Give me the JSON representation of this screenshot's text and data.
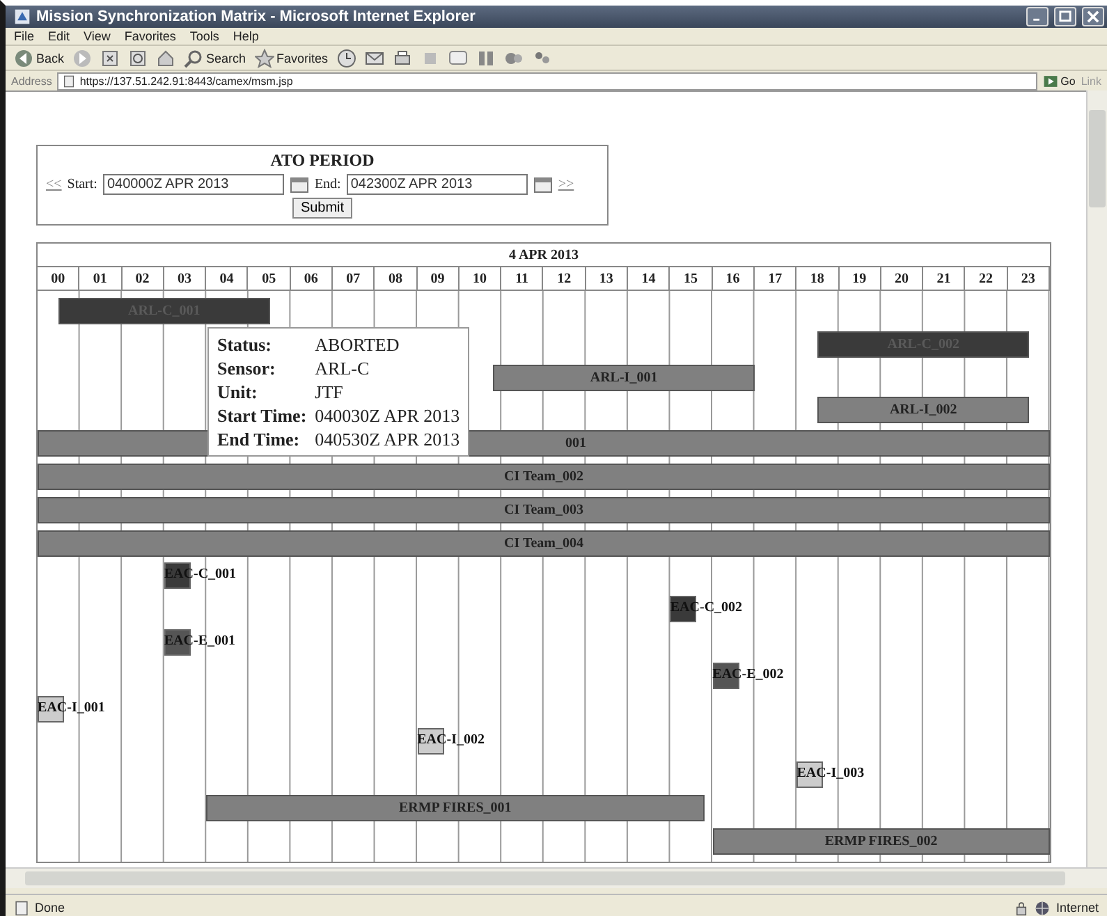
{
  "window": {
    "title": "Mission Synchronization Matrix - Microsoft Internet Explorer"
  },
  "menu": [
    "File",
    "Edit",
    "View",
    "Favorites",
    "Tools",
    "Help"
  ],
  "toolbar": {
    "back": "Back",
    "search": "Search",
    "favorites": "Favorites"
  },
  "address": {
    "label": "Address",
    "url": "https://137.51.242.91:8443/camex/msm.jsp",
    "go": "Go",
    "links": "Link"
  },
  "ato_period": {
    "title": "ATO PERIOD",
    "prev": "<<",
    "start_label": "Start:",
    "start_value": "040000Z APR 2013",
    "end_label": "End:",
    "end_value": "042300Z APR 2013",
    "next": ">>",
    "submit": "Submit"
  },
  "matrix": {
    "date": "4 APR 2013",
    "hours": [
      "00",
      "01",
      "02",
      "03",
      "04",
      "05",
      "06",
      "07",
      "08",
      "09",
      "10",
      "11",
      "12",
      "13",
      "14",
      "15",
      "16",
      "17",
      "18",
      "19",
      "20",
      "21",
      "22",
      "23"
    ],
    "rows": [
      {
        "label": "ARL-C_001",
        "kind": "span",
        "color": "#3a3a3a"
      },
      {
        "label": "ARL-C_002",
        "kind": "span",
        "color": "#3a3a3a"
      },
      {
        "label": "ARL-I_001",
        "kind": "span",
        "color": "#808080"
      },
      {
        "label": "ARL-I_002",
        "kind": "span",
        "color": "#808080"
      },
      {
        "label": "001",
        "kind": "span",
        "color": "#808080",
        "clipped": true
      },
      {
        "label": "CI Team_002",
        "kind": "span",
        "color": "#808080"
      },
      {
        "label": "CI Team_003",
        "kind": "span",
        "color": "#808080"
      },
      {
        "label": "CI Team_004",
        "kind": "span",
        "color": "#808080"
      },
      {
        "label": "EAC-C_001",
        "kind": "event",
        "color": "#3a3a3a"
      },
      {
        "label": "EAC-C_002",
        "kind": "event",
        "color": "#3a3a3a"
      },
      {
        "label": "EAC-E_001",
        "kind": "event",
        "color": "#555555"
      },
      {
        "label": "EAC-E_002",
        "kind": "event",
        "color": "#555555"
      },
      {
        "label": "EAC-I_001",
        "kind": "event",
        "color": "#cccccc"
      },
      {
        "label": "EAC-I_002",
        "kind": "event",
        "color": "#cccccc"
      },
      {
        "label": "EAC-I_003",
        "kind": "event",
        "color": "#cccccc"
      },
      {
        "label": "ERMP FIRES_001",
        "kind": "span",
        "color": "#808080"
      },
      {
        "label": "ERMP FIRES_002",
        "kind": "span",
        "color": "#808080"
      }
    ]
  },
  "tooltip": {
    "fields": [
      {
        "label": "Status:",
        "value": "ABORTED"
      },
      {
        "label": "Sensor:",
        "value": "ARL-C"
      },
      {
        "label": "Unit:",
        "value": "JTF"
      },
      {
        "label": "Start Time:",
        "value": "040030Z APR 2013"
      },
      {
        "label": "End Time:",
        "value": "040530Z APR 2013"
      }
    ]
  },
  "status_bar": {
    "text": "Done",
    "zone": "Internet"
  }
}
